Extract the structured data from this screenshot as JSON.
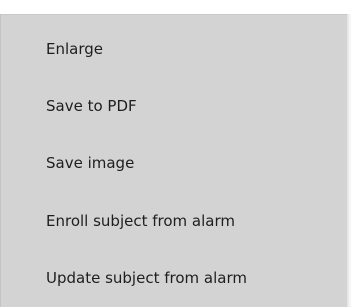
{
  "context_menu": {
    "items": [
      {
        "label": "Enlarge"
      },
      {
        "label": "Save to PDF"
      },
      {
        "label": "Save image"
      },
      {
        "label": "Enroll subject from alarm"
      },
      {
        "label": "Update subject from alarm"
      }
    ]
  },
  "colors": {
    "menu_background": "#d3d3d3",
    "text": "#1e1e1e",
    "page_background": "#ffffff"
  }
}
